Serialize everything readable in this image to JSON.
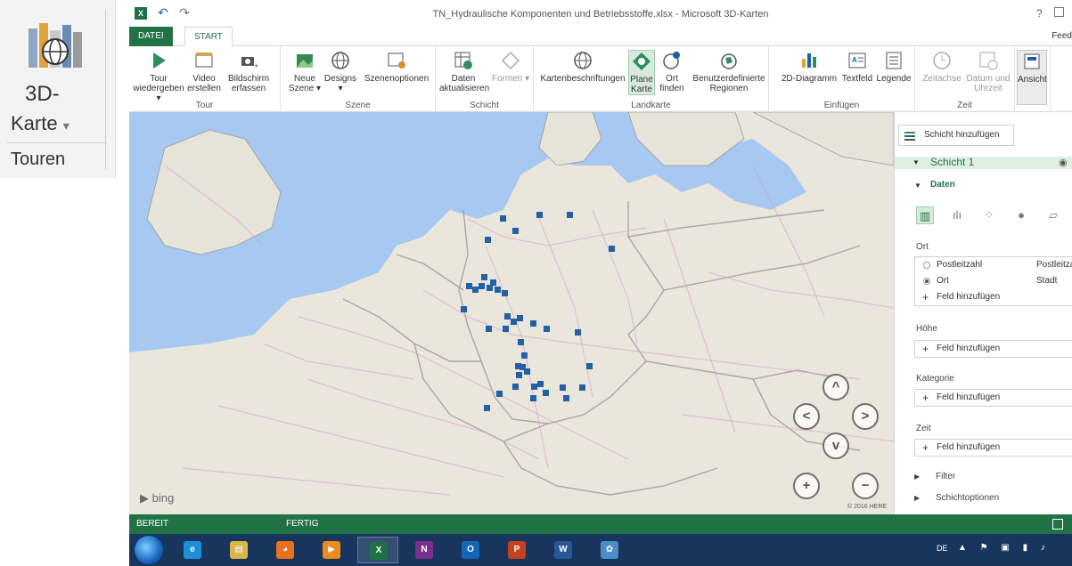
{
  "thumbnail": {
    "line1": "3D-",
    "line2": "Karte",
    "line2_arrow": "▾",
    "line3": "Touren"
  },
  "window": {
    "title": "TN_Hydraulische Komponenten und Betriebsstoffe.xlsx - Microsoft 3D-Karten",
    "help": "?",
    "app_icon": "X"
  },
  "tabs": {
    "file": "DATEI",
    "start": "START",
    "feedback": "Feed"
  },
  "ribbon": {
    "groups": {
      "tour": "Tour",
      "szene": "Szene",
      "schicht": "Schicht",
      "landkarte": "Landkarte",
      "einfuegen": "Einfügen",
      "zeit": "Zeit"
    },
    "buttons": {
      "tour_play": "Tour wiedergeben ▾",
      "video": "Video erstellen",
      "screenshot": "Bildschirm erfassen",
      "new_scene": "Neue Szene ▾",
      "designs": "Designs ▾",
      "scene_options": "Szenenoptionen",
      "refresh": "Daten aktualisieren",
      "shapes": "Formen ▾",
      "map_labels": "Kartenbeschriftungen",
      "flat_map": "Plane Karte",
      "find_location": "Ort finden",
      "custom_regions": "Benutzerdefinierte Regionen",
      "chart2d": "2D-Diagramm",
      "textbox": "Textfeld",
      "legend": "Legende",
      "timeline": "Zeitachse",
      "datetime": "Datum und Uhrzeit",
      "view": "Ansicht"
    }
  },
  "map": {
    "logo": "bing",
    "copyright": "© 2016 HERE",
    "point_color": "#2360a5",
    "nav": {
      "up": "^",
      "left": "<",
      "right": ">",
      "down": "v",
      "zoom_in": "+",
      "zoom_out": "−"
    }
  },
  "pane": {
    "add_layer": "Schicht hinzufügen",
    "layer_title": "Schicht 1",
    "data_header": "Daten",
    "location_label": "Ort",
    "location_options": [
      {
        "label": "Postleitzahl",
        "type": "Postleitzahl",
        "selected": false
      },
      {
        "label": "Ort",
        "type": "Stadt",
        "selected": true
      }
    ],
    "add_field": "Feld hinzufügen",
    "height_label": "Höhe",
    "category_label": "Kategorie",
    "time_label": "Zeit",
    "filter": "Filter",
    "layer_options": "Schichtoptionen"
  },
  "status": {
    "left": "BEREIT",
    "middle": "FERTIG"
  },
  "taskbar": {
    "lang": "DE",
    "apps": [
      {
        "name": "ie",
        "glyph": "e",
        "color": "#1c8fd8"
      },
      {
        "name": "explorer",
        "glyph": "▤",
        "color": "#d9b54a"
      },
      {
        "name": "firefox",
        "glyph": "◕",
        "color": "#e8701f"
      },
      {
        "name": "media",
        "glyph": "▶",
        "color": "#f08a1c"
      },
      {
        "name": "excel",
        "glyph": "X",
        "color": "#1e7145"
      },
      {
        "name": "onenote",
        "glyph": "N",
        "color": "#7b2f8f"
      },
      {
        "name": "outlook",
        "glyph": "O",
        "color": "#1565b8"
      },
      {
        "name": "powerpoint",
        "glyph": "P",
        "color": "#c4421d"
      },
      {
        "name": "word",
        "glyph": "W",
        "color": "#2b5797"
      },
      {
        "name": "paint",
        "glyph": "✿",
        "color": "#4c8dc7"
      }
    ]
  }
}
